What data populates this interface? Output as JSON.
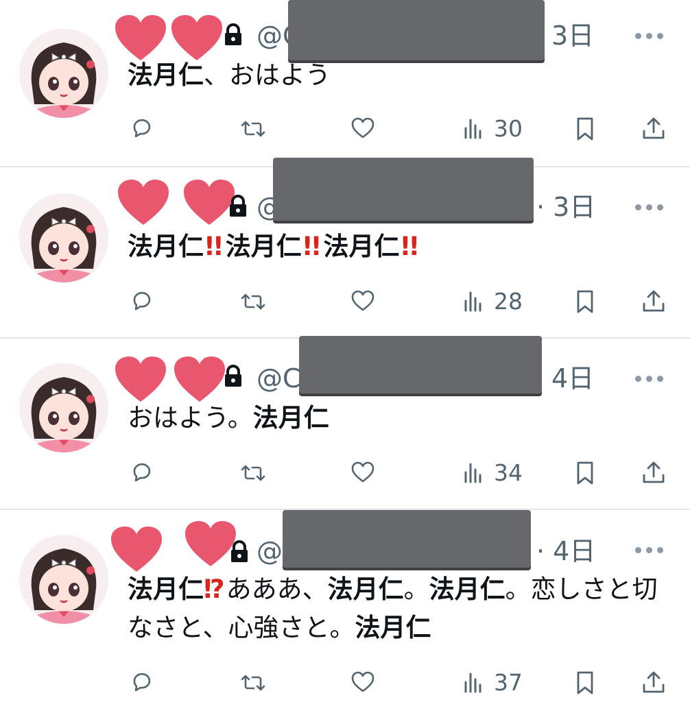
{
  "tweets": [
    {
      "handle": "@C",
      "time": "3日",
      "views": "30",
      "text": [
        {
          "t": "法月仁",
          "style": "bold"
        },
        {
          "t": "、おはよう",
          "style": "normal"
        }
      ]
    },
    {
      "handle": "@",
      "time": "· 3日",
      "views": "28",
      "text": [
        {
          "t": "法月仁",
          "style": "bold"
        },
        {
          "t": "!!",
          "style": "bang"
        },
        {
          "t": "法月仁",
          "style": "bold"
        },
        {
          "t": "!!",
          "style": "bang"
        },
        {
          "t": "法月仁",
          "style": "bold"
        },
        {
          "t": "!!",
          "style": "bang"
        }
      ]
    },
    {
      "handle": "@C",
      "time": "4日",
      "views": "34",
      "text": [
        {
          "t": "おはよう。",
          "style": "normal"
        },
        {
          "t": "法月仁",
          "style": "bold"
        }
      ]
    },
    {
      "handle": "@",
      "time": "· 4日",
      "views": "37",
      "text": [
        {
          "t": "法月仁",
          "style": "bold"
        },
        {
          "t": "⁉",
          "style": "bang"
        },
        {
          "t": "あああ、",
          "style": "normal"
        },
        {
          "t": "法月仁",
          "style": "bold"
        },
        {
          "t": "。",
          "style": "normal"
        },
        {
          "t": "法月仁",
          "style": "bold"
        },
        {
          "t": "。恋しさと切なさと、心強さと。",
          "style": "normal"
        },
        {
          "t": "法月仁",
          "style": "bold"
        }
      ]
    }
  ],
  "icons": {
    "reply": "speech-bubble-icon",
    "retweet": "retweet-arrows-icon",
    "like": "heart-outline-icon",
    "views": "bar-chart-icon",
    "bookmark": "bookmark-icon",
    "share": "share-upload-icon",
    "more": "three-dots-icon",
    "protected": "lock-icon"
  },
  "colors": {
    "text": "#0f1419",
    "secondary": "#536471",
    "heart_sticker": "#e8576e",
    "emoji_red": "#d9261c",
    "redaction": "#66686b"
  }
}
